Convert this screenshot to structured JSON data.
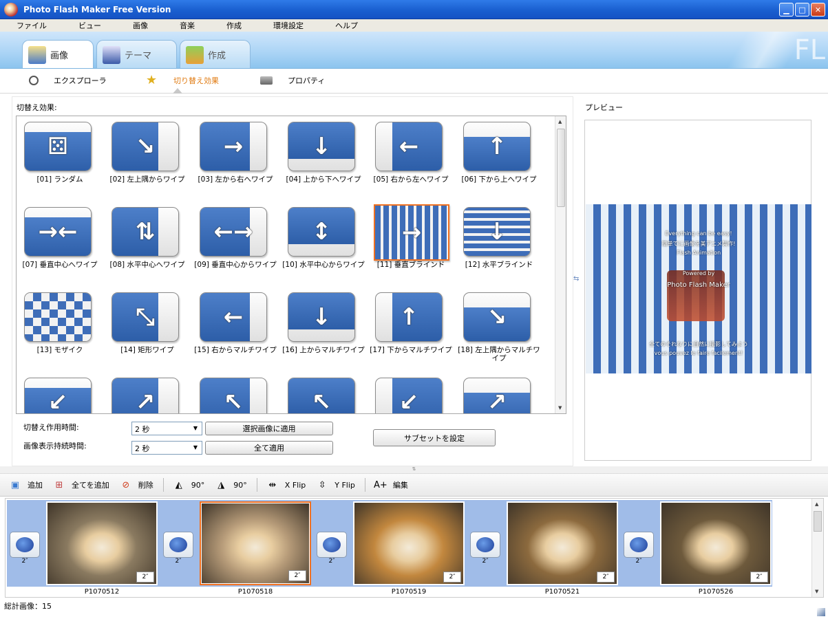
{
  "window": {
    "title": "Photo Flash Maker Free Version"
  },
  "menu": [
    "ファイル",
    "ビュー",
    "画像",
    "音楽",
    "作成",
    "環境設定",
    "ヘルプ"
  ],
  "tabs": [
    {
      "label": "画像",
      "active": true
    },
    {
      "label": "テーマ",
      "active": false
    },
    {
      "label": "作成",
      "active": false
    }
  ],
  "subtabs": [
    {
      "label": "エクスプローラ"
    },
    {
      "label": "切り替え効果",
      "selected": true
    },
    {
      "label": "プロパティ"
    }
  ],
  "left": {
    "section_label": "切替え効果:",
    "effects": [
      {
        "label": "[01] ランダム",
        "glyph": "⚄"
      },
      {
        "label": "[02] 左上隅からワイプ",
        "glyph": "↘"
      },
      {
        "label": "[03] 左から右へワイプ",
        "glyph": "→"
      },
      {
        "label": "[04] 上から下へワイプ",
        "glyph": "↓"
      },
      {
        "label": "[05] 右から左へワイプ",
        "glyph": "←"
      },
      {
        "label": "[06] 下から上へワイプ",
        "glyph": "↑"
      },
      {
        "label": "[07] 垂直中心へワイプ",
        "glyph": "→←"
      },
      {
        "label": "[08] 水平中心へワイプ",
        "glyph": "⇅"
      },
      {
        "label": "[09] 垂直中心からワイプ",
        "glyph": "←→"
      },
      {
        "label": "[10] 水平中心からワイプ",
        "glyph": "↕"
      },
      {
        "label": "[11] 垂直ブラインド",
        "glyph": "→",
        "selected": true
      },
      {
        "label": "[12] 水平ブラインド",
        "glyph": "↓"
      },
      {
        "label": "[13] モザイク",
        "glyph": ""
      },
      {
        "label": "[14] 矩形ワイプ",
        "glyph": "⤡"
      },
      {
        "label": "[15] 右からマルチワイプ",
        "glyph": "←"
      },
      {
        "label": "[16] 上からマルチワイプ",
        "glyph": "↓"
      },
      {
        "label": "[17] 下からマルチワイプ",
        "glyph": "↑"
      },
      {
        "label": "[18] 左上隅からマルチワイプ",
        "glyph": "↘"
      },
      {
        "label": "",
        "glyph": "↙"
      },
      {
        "label": "",
        "glyph": "↗"
      },
      {
        "label": "",
        "glyph": "↖"
      },
      {
        "label": "",
        "glyph": "↖"
      },
      {
        "label": "",
        "glyph": "↙"
      },
      {
        "label": "",
        "glyph": "↗"
      }
    ],
    "transition_time_label": "切替え作用時間:",
    "transition_time_value": "2 秒",
    "display_time_label": "画像表示持続時間:",
    "display_time_value": "2 秒",
    "apply_selected": "選択画像に適用",
    "apply_all": "全て適用",
    "subset": "サブセットを設定"
  },
  "preview": {
    "label": "プレビュー",
    "texts": [
      "Everything can be easy!",
      "簡単でに画像を美アニメ製作!",
      "Flash Animation",
      "Powered by",
      "Photo Flash Maker",
      "全てのそれなりに自然に撮影してみよう",
      "vous pouvez le faire facilement!"
    ]
  },
  "toolbar": {
    "add": "追加",
    "add_all": "全てを追加",
    "delete": "削除",
    "rot_left": "90°",
    "rot_right": "90°",
    "xflip": "X Flip",
    "yflip": "Y Flip",
    "edit": "編集"
  },
  "strip": {
    "transition_duration": "2″",
    "photos": [
      {
        "name": "P1070512",
        "duration": "2″",
        "tone": "#8a7a60"
      },
      {
        "name": "P1070518",
        "duration": "2″",
        "tone": "#b59a78",
        "selected": true
      },
      {
        "name": "P1070519",
        "duration": "2″",
        "tone": "#c2873e"
      },
      {
        "name": "P1070521",
        "duration": "2″",
        "tone": "#8c6a3e"
      },
      {
        "name": "P1070526",
        "duration": "2″",
        "tone": "#6e5a3c"
      }
    ]
  },
  "status": {
    "total": "総計画像：15"
  }
}
